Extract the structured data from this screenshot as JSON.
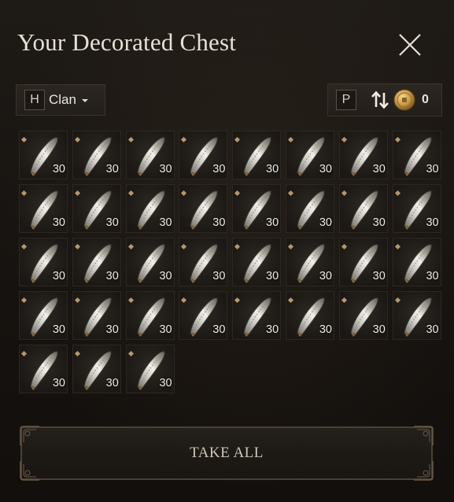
{
  "window": {
    "title": "Your Decorated Chest"
  },
  "controls": {
    "clan_key": "H",
    "clan_label": "Clan",
    "currency_key": "P",
    "coin_count": "0"
  },
  "items": [
    {
      "qty": "30"
    },
    {
      "qty": "30"
    },
    {
      "qty": "30"
    },
    {
      "qty": "30"
    },
    {
      "qty": "30"
    },
    {
      "qty": "30"
    },
    {
      "qty": "30"
    },
    {
      "qty": "30"
    },
    {
      "qty": "30"
    },
    {
      "qty": "30"
    },
    {
      "qty": "30"
    },
    {
      "qty": "30"
    },
    {
      "qty": "30"
    },
    {
      "qty": "30"
    },
    {
      "qty": "30"
    },
    {
      "qty": "30"
    },
    {
      "qty": "30"
    },
    {
      "qty": "30"
    },
    {
      "qty": "30"
    },
    {
      "qty": "30"
    },
    {
      "qty": "30"
    },
    {
      "qty": "30"
    },
    {
      "qty": "30"
    },
    {
      "qty": "30"
    },
    {
      "qty": "30"
    },
    {
      "qty": "30"
    },
    {
      "qty": "30"
    },
    {
      "qty": "30"
    },
    {
      "qty": "30"
    },
    {
      "qty": "30"
    },
    {
      "qty": "30"
    },
    {
      "qty": "30"
    },
    {
      "qty": "30"
    },
    {
      "qty": "30"
    },
    {
      "qty": "30"
    }
  ],
  "footer": {
    "take_all_label": "TAKE ALL"
  },
  "icons": {
    "close": "close-icon",
    "dropdown": "chevron-down-icon",
    "sort": "sort-arrows-icon",
    "coin": "coin-icon",
    "item": "item-icon"
  },
  "colors": {
    "background": "#16120f",
    "accent": "#b49a6a",
    "text": "#e6e0d6"
  }
}
